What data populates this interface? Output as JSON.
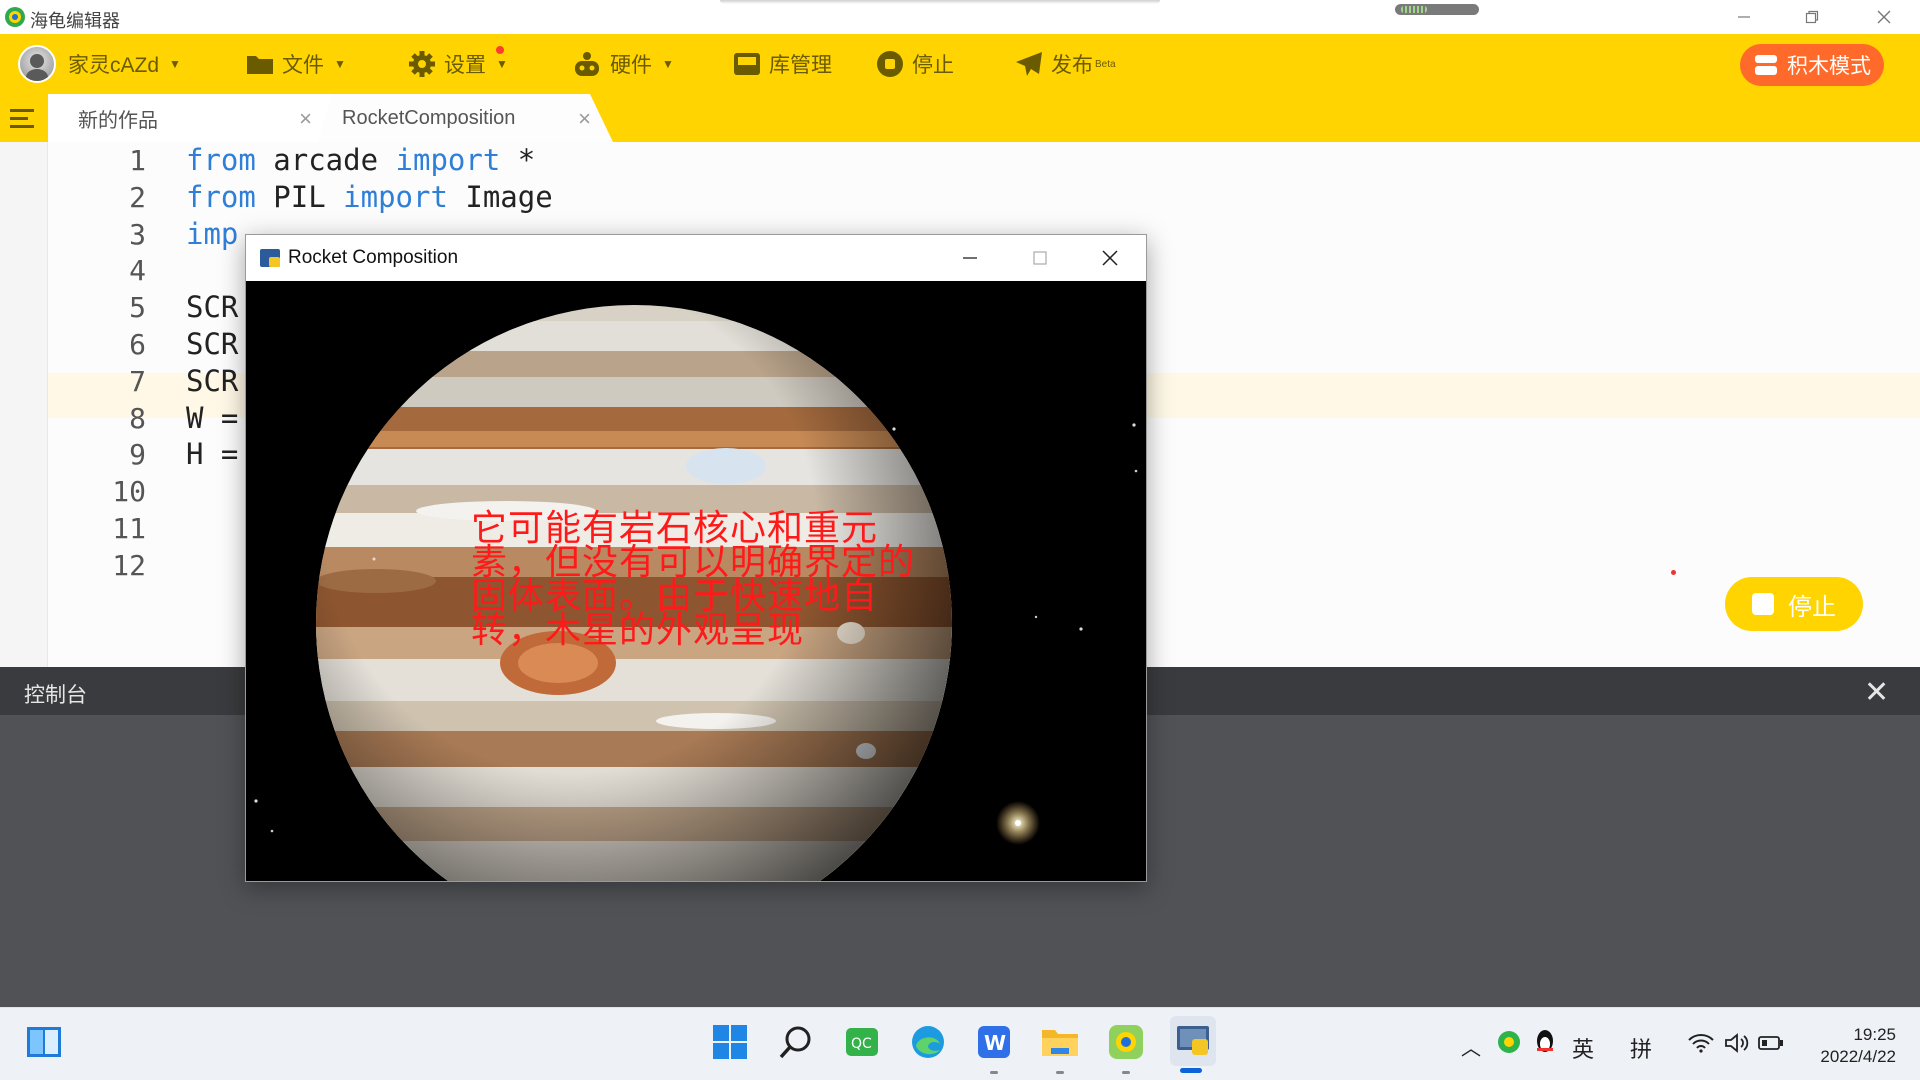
{
  "titlebar": {
    "title": "海龟编辑器"
  },
  "toolbar": {
    "user": "家灵cAZd",
    "file": "文件",
    "settings": "设置",
    "hardware": "硬件",
    "library": "库管理",
    "stop": "停止",
    "publish": "发布",
    "publish_badge": "Beta",
    "block_mode": "积木模式"
  },
  "tabs": [
    {
      "label": "新的作品"
    },
    {
      "label": "RocketComposition"
    }
  ],
  "editor": {
    "line_numbers": [
      "1",
      "2",
      "3",
      "4",
      "5",
      "6",
      "7",
      "8",
      "9",
      "10",
      "11",
      "12"
    ],
    "lines": [
      {
        "kw1": "from",
        "mid": " arcade ",
        "kw2": "import",
        "rest": " *"
      },
      {
        "kw1": "from",
        "mid": " PIL ",
        "kw2": "import",
        "rest": " Image"
      },
      {
        "kw1": "imp",
        "mid": "",
        "kw2": "",
        "rest": ""
      },
      {
        "kw1": "",
        "mid": "",
        "kw2": "",
        "rest": ""
      },
      {
        "kw1": "",
        "mid": "SCR",
        "kw2": "",
        "rest": ""
      },
      {
        "kw1": "",
        "mid": "SCR",
        "kw2": "",
        "rest": ""
      },
      {
        "kw1": "",
        "mid": "SCR",
        "kw2": "",
        "rest": ""
      },
      {
        "kw1": "",
        "mid": "W =",
        "kw2": "",
        "rest": ""
      },
      {
        "kw1": "",
        "mid": "H =",
        "kw2": "",
        "rest": ""
      },
      {
        "kw1": "",
        "mid": "",
        "kw2": "",
        "rest": ""
      },
      {
        "kw1": "",
        "mid": "",
        "kw2": "",
        "rest": ""
      },
      {
        "kw1": "",
        "mid": "",
        "kw2": "",
        "rest": ""
      }
    ]
  },
  "stop_button": "停止",
  "console": {
    "title": "控制台"
  },
  "rocket_window": {
    "title": "Rocket Composition",
    "overlay_text": "它可能有岩石核心和重元素，但没有可以明确界定的固体表面。由于快速地自转，木星的外观呈现"
  },
  "taskbar": {
    "tray_lang": "英",
    "tray_ime": "拼",
    "time": "19:25",
    "date": "2022/4/22"
  },
  "colors": {
    "accent_yellow": "#ffd400",
    "block_mode_orange": "#ff6a2a",
    "keyword_blue": "#2f7fd8",
    "overlay_red": "#ff1a1a",
    "console_dark": "#3a3b3e"
  }
}
